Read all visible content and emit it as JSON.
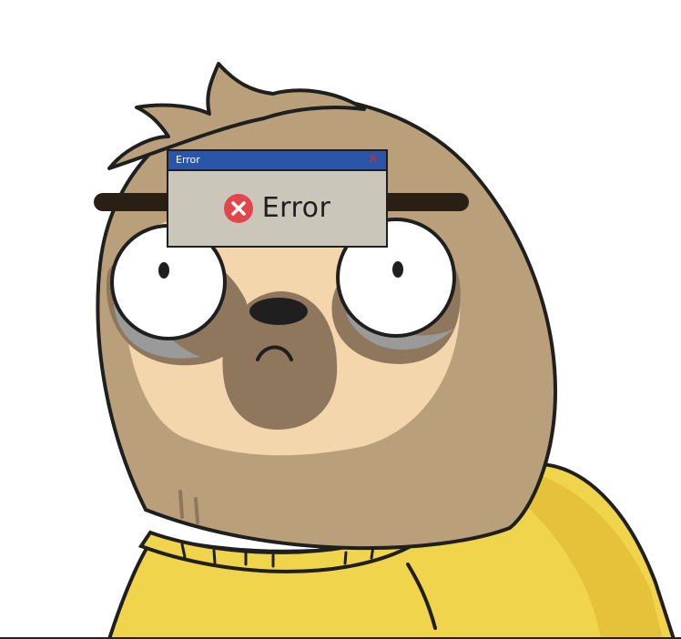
{
  "dialog": {
    "title": "Error",
    "message": "Error",
    "close_glyph": "✕",
    "icons": {
      "error": "error-circle-x-icon",
      "close": "close-icon"
    }
  },
  "colors": {
    "titlebar": "#2a55a8",
    "dialog_body": "#cbc6ba",
    "error_icon": "#e2454c",
    "sweater": "#f0d44c",
    "fur_dark": "#b9a07a",
    "face_light": "#f4d6ad",
    "snout": "#8e775c"
  }
}
